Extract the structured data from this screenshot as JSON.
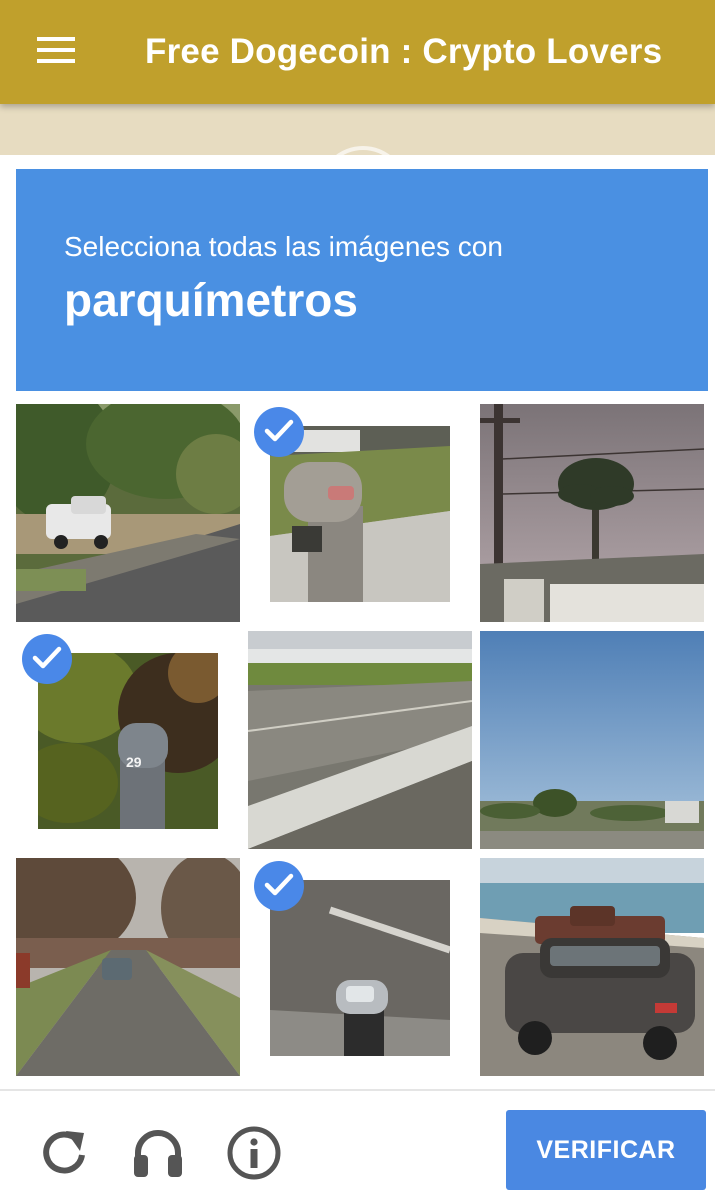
{
  "app_bar": {
    "title": "Free Dogecoin : Crypto Lovers",
    "menu_icon": "hamburger-menu-icon",
    "color": "#c0a02c"
  },
  "captcha": {
    "instruction_prefix": "Selecciona todas las imágenes con",
    "target_object": "parquímetros",
    "banner_color": "#4a90e2",
    "tiles": [
      {
        "index": 1,
        "selected": false
      },
      {
        "index": 2,
        "selected": true
      },
      {
        "index": 3,
        "selected": false
      },
      {
        "index": 4,
        "selected": true
      },
      {
        "index": 5,
        "selected": false
      },
      {
        "index": 6,
        "selected": false
      },
      {
        "index": 7,
        "selected": false
      },
      {
        "index": 8,
        "selected": true
      },
      {
        "index": 9,
        "selected": false
      }
    ],
    "footer": {
      "reload_icon": "reload-icon",
      "audio_icon": "headphones-icon",
      "info_icon": "info-icon",
      "verify_label": "VERIFICAR",
      "verify_color": "#4a88e2"
    }
  }
}
